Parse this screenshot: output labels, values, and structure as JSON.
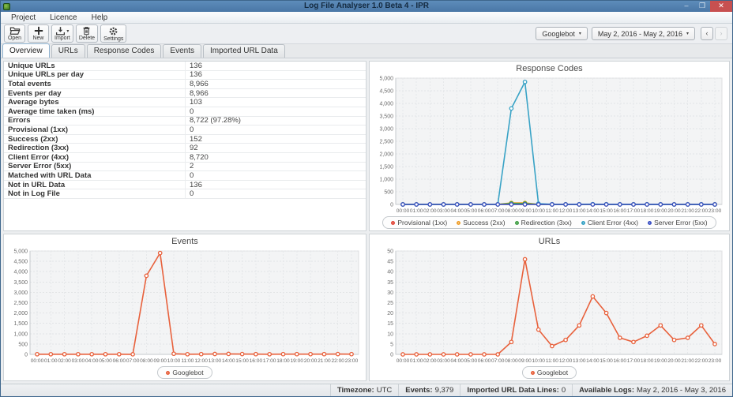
{
  "window": {
    "title": "Log File Analyser 1.0 Beta 4 - IPR",
    "controls": [
      {
        "name": "minimize-icon",
        "glyph": "–"
      },
      {
        "name": "maximize-icon",
        "glyph": "❒"
      },
      {
        "name": "close-icon",
        "glyph": "✕"
      }
    ]
  },
  "menu": {
    "items": [
      "Project",
      "Licence",
      "Help"
    ]
  },
  "toolbar": {
    "buttons": [
      {
        "label": "Open",
        "icon": "open-folder-icon",
        "has_dropdown": false
      },
      {
        "label": "New",
        "icon": "plus-icon",
        "has_dropdown": false
      },
      {
        "label": "Import",
        "icon": "import-icon",
        "has_dropdown": true
      },
      {
        "label": "Delete",
        "icon": "trash-icon",
        "has_dropdown": false
      },
      {
        "label": "Settings",
        "icon": "gear-icon",
        "has_dropdown": false
      }
    ],
    "bot_filter": {
      "value": "Googlebot",
      "caret": "▾"
    },
    "date_range": {
      "value": "May 2, 2016 - May 2, 2016",
      "caret": "▾"
    },
    "prev_label": "‹",
    "next_label": "›"
  },
  "tabs": {
    "items": [
      "Overview",
      "URLs",
      "Response Codes",
      "Events",
      "Imported URL Data"
    ],
    "active": "Overview"
  },
  "overview_table": {
    "rows": [
      {
        "label": "Unique URLs",
        "value": "136"
      },
      {
        "label": "Unique URLs per day",
        "value": "136"
      },
      {
        "label": "Total events",
        "value": "8,966"
      },
      {
        "label": "Events per day",
        "value": "8,966"
      },
      {
        "label": "Average bytes",
        "value": "103"
      },
      {
        "label": "Average time taken (ms)",
        "value": "0"
      },
      {
        "label": "Errors",
        "value": "8,722 (97.28%)"
      },
      {
        "label": "Provisional (1xx)",
        "value": "0"
      },
      {
        "label": "Success (2xx)",
        "value": "152"
      },
      {
        "label": "Redirection (3xx)",
        "value": "92"
      },
      {
        "label": "Client Error (4xx)",
        "value": "8,720"
      },
      {
        "label": "Server Error (5xx)",
        "value": "2"
      },
      {
        "label": "Matched with URL Data",
        "value": "0"
      },
      {
        "label": "Not in URL Data",
        "value": "136"
      },
      {
        "label": "Not in Log File",
        "value": "0"
      }
    ]
  },
  "status_bar": {
    "items": [
      {
        "label": "Timezone:",
        "value": "UTC"
      },
      {
        "label": "Events:",
        "value": "9,379"
      },
      {
        "label": "Imported URL Data Lines:",
        "value": "0"
      },
      {
        "label": "Available Logs:",
        "value": "May 2, 2016 - May 3, 2016"
      }
    ]
  },
  "colors": {
    "titlebar": "#4d7cab",
    "close_button": "#c75050",
    "provisional_1xx": "#e2493b",
    "success_2xx": "#efa02e",
    "redirection_3xx": "#43a047",
    "client_error_4xx": "#39a3c6",
    "server_error_5xx": "#3d52c5",
    "googlebot_orange": "#e8613c"
  },
  "chart_data": [
    {
      "id": "response_codes",
      "type": "line",
      "title": "Response Codes",
      "categories": [
        "00:00",
        "01:00",
        "02:00",
        "03:00",
        "04:00",
        "05:00",
        "06:00",
        "07:00",
        "08:00",
        "09:00",
        "10:00",
        "11:00",
        "12:00",
        "13:00",
        "14:00",
        "15:00",
        "16:00",
        "17:00",
        "18:00",
        "19:00",
        "20:00",
        "21:00",
        "22:00",
        "23:00"
      ],
      "xlabel": "",
      "ylabel": "",
      "ylim": [
        0,
        5000
      ],
      "ystep": 500,
      "grid": true,
      "legend_position": "bottom",
      "series": [
        {
          "name": "Provisional (1xx)",
          "color": "#e2493b",
          "values": [
            0,
            0,
            0,
            0,
            0,
            0,
            0,
            0,
            0,
            0,
            0,
            0,
            0,
            0,
            0,
            0,
            0,
            0,
            0,
            0,
            0,
            0,
            0,
            0
          ]
        },
        {
          "name": "Success (2xx)",
          "color": "#efa02e",
          "values": [
            1,
            1,
            1,
            1,
            1,
            1,
            1,
            2,
            60,
            60,
            4,
            2,
            2,
            3,
            3,
            3,
            2,
            2,
            2,
            2,
            1,
            1,
            2,
            1
          ]
        },
        {
          "name": "Redirection (3xx)",
          "color": "#43a047",
          "values": [
            0,
            0,
            0,
            0,
            0,
            0,
            0,
            1,
            40,
            35,
            3,
            1,
            1,
            1,
            2,
            2,
            1,
            1,
            1,
            1,
            0,
            0,
            1,
            1
          ]
        },
        {
          "name": "Client Error (4xx)",
          "color": "#39a3c6",
          "values": [
            0,
            0,
            0,
            0,
            0,
            0,
            0,
            2,
            3800,
            4850,
            30,
            5,
            4,
            6,
            8,
            5,
            2,
            2,
            2,
            2,
            1,
            1,
            2,
            1
          ]
        },
        {
          "name": "Server Error (5xx)",
          "color": "#3d52c5",
          "values": [
            0,
            0,
            0,
            0,
            0,
            0,
            0,
            0,
            1,
            1,
            0,
            0,
            0,
            0,
            0,
            0,
            0,
            0,
            0,
            0,
            0,
            0,
            0,
            0
          ]
        }
      ]
    },
    {
      "id": "events",
      "type": "line",
      "title": "Events",
      "categories": [
        "00:00",
        "01:00",
        "02:00",
        "03:00",
        "04:00",
        "05:00",
        "06:00",
        "07:00",
        "08:00",
        "09:00",
        "10:00",
        "11:00",
        "12:00",
        "13:00",
        "14:00",
        "15:00",
        "16:00",
        "17:00",
        "18:00",
        "19:00",
        "20:00",
        "21:00",
        "22:00",
        "23:00"
      ],
      "xlabel": "",
      "ylabel": "",
      "ylim": [
        0,
        5000
      ],
      "ystep": 500,
      "grid": true,
      "legend_position": "bottom",
      "series": [
        {
          "name": "Googlebot",
          "color": "#e8613c",
          "values": [
            8,
            8,
            8,
            8,
            8,
            8,
            8,
            5,
            3800,
            4900,
            30,
            8,
            10,
            18,
            22,
            15,
            10,
            8,
            12,
            12,
            10,
            10,
            14,
            12
          ]
        }
      ]
    },
    {
      "id": "urls",
      "type": "line",
      "title": "URLs",
      "categories": [
        "00:00",
        "01:00",
        "02:00",
        "03:00",
        "04:00",
        "05:00",
        "06:00",
        "07:00",
        "08:00",
        "09:00",
        "10:00",
        "11:00",
        "12:00",
        "13:00",
        "14:00",
        "15:00",
        "16:00",
        "17:00",
        "18:00",
        "19:00",
        "20:00",
        "21:00",
        "22:00",
        "23:00"
      ],
      "xlabel": "",
      "ylabel": "",
      "ylim": [
        0,
        50
      ],
      "ystep": 5,
      "grid": true,
      "legend_position": "bottom",
      "series": [
        {
          "name": "Googlebot",
          "color": "#e8613c",
          "values": [
            0,
            0,
            0,
            0,
            0,
            0,
            0,
            0,
            6,
            46,
            12,
            4,
            7,
            14,
            28,
            20,
            8,
            6,
            9,
            14,
            7,
            8,
            14,
            5
          ]
        }
      ]
    }
  ]
}
